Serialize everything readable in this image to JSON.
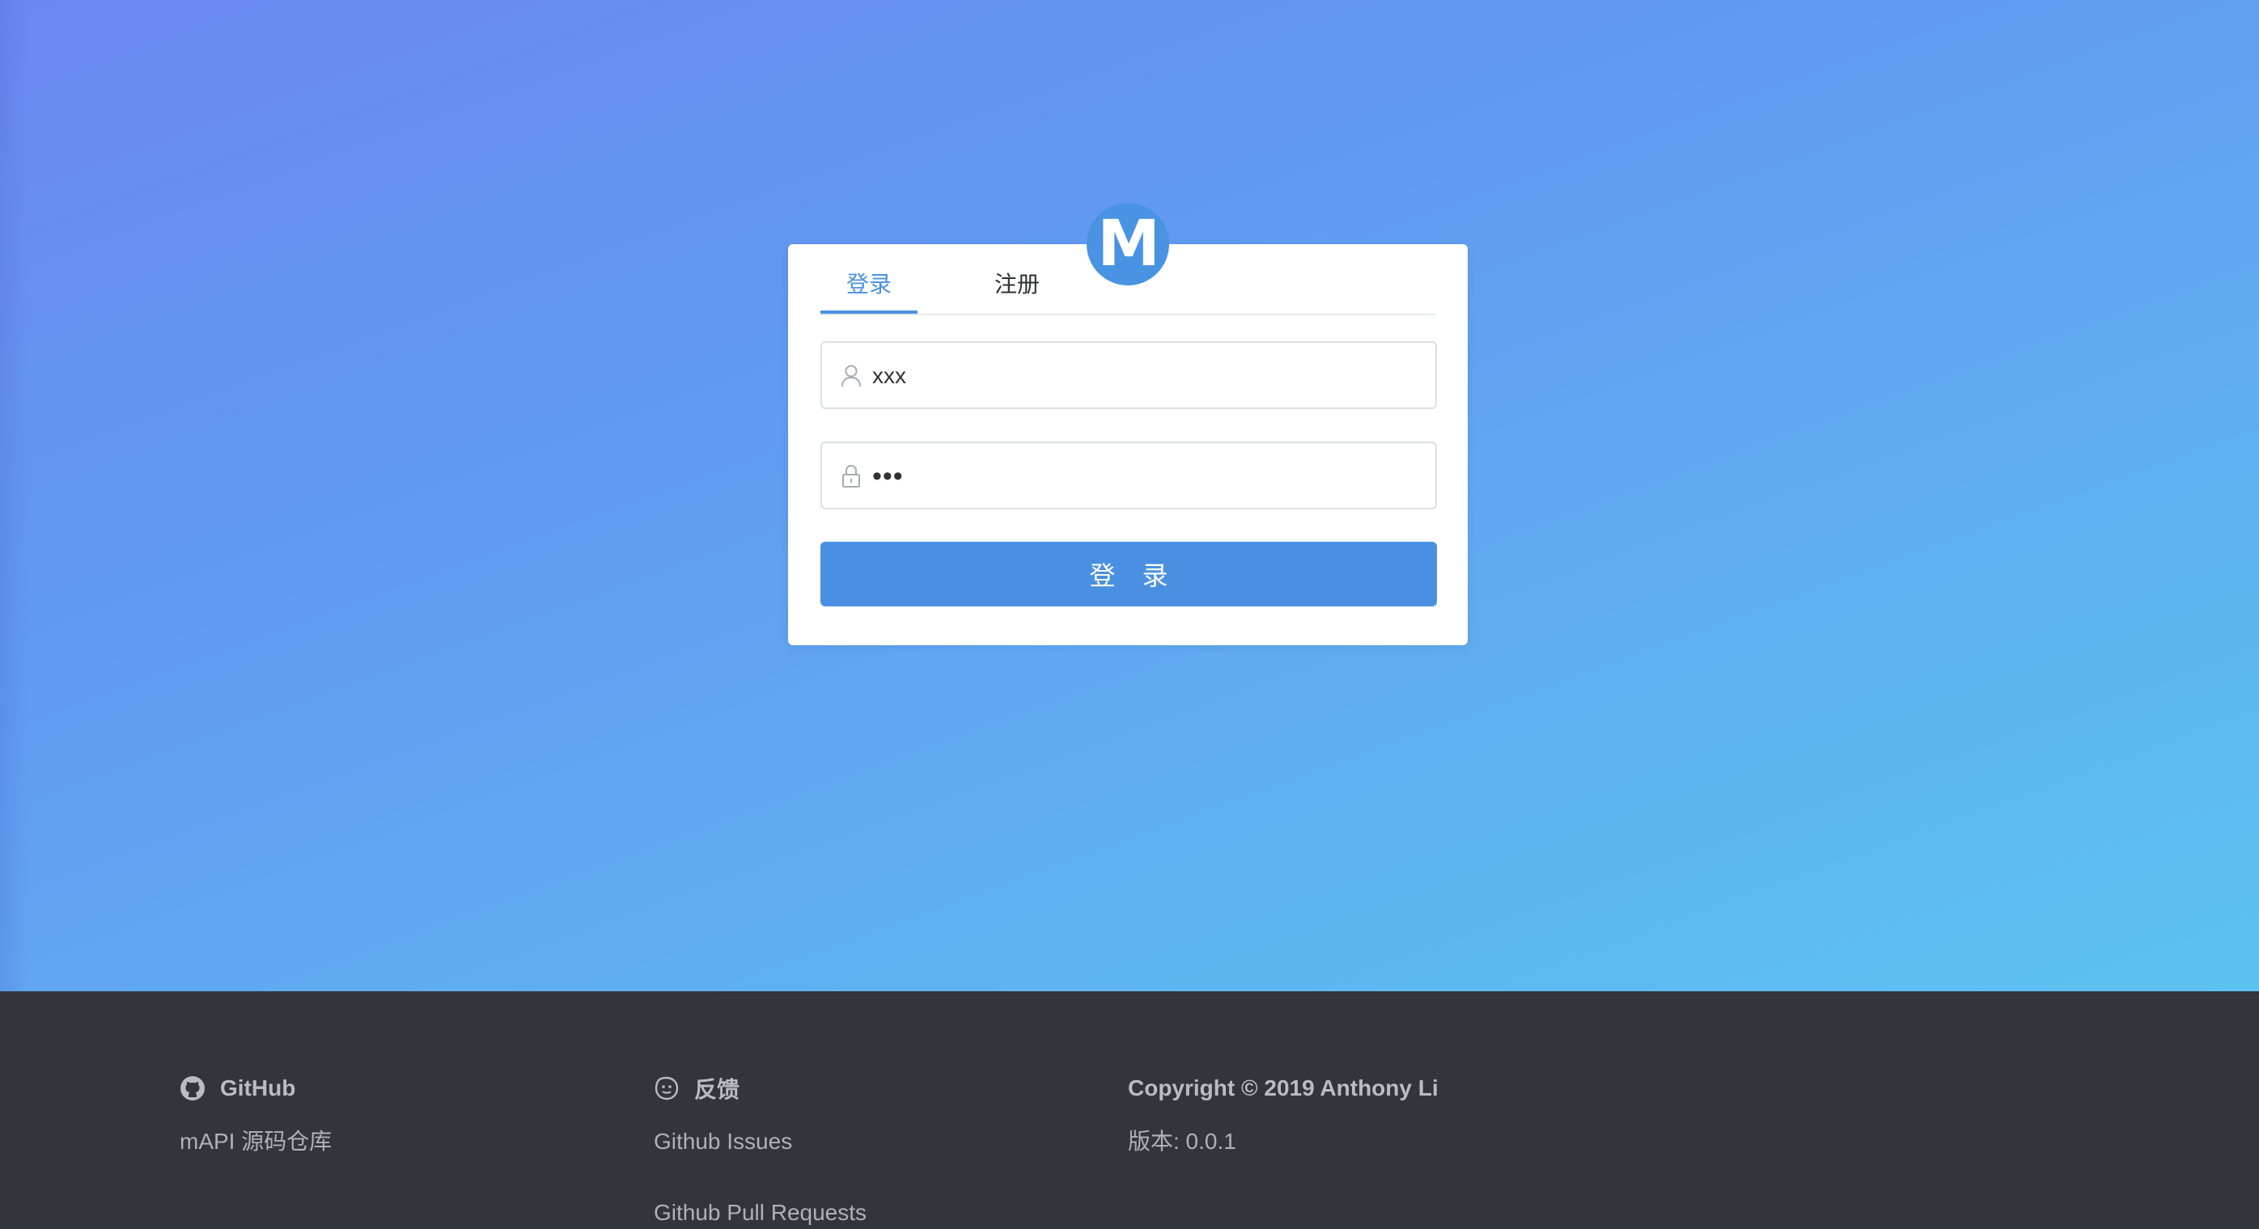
{
  "logo": {
    "letter": "M",
    "color": "#4a93e2"
  },
  "tabs": [
    {
      "label": "登录",
      "active": true
    },
    {
      "label": "注册",
      "active": false
    }
  ],
  "form": {
    "username": {
      "value": "xxx",
      "icon": "user-icon"
    },
    "password": {
      "value": "•••",
      "icon": "lock-icon"
    },
    "submit_label": "登 录"
  },
  "footer": {
    "github": {
      "heading": "GitHub",
      "icon": "github-icon",
      "links": [
        "mAPI 源码仓库"
      ]
    },
    "feedback": {
      "heading": "反馈",
      "icon": "smile-icon",
      "links": [
        "Github Issues",
        "Github Pull Requests"
      ]
    },
    "about": {
      "copyright": "Copyright © 2019 Anthony Li",
      "version": "版本: 0.0.1"
    }
  },
  "colors": {
    "accent": "#4a90e2",
    "footer_bg": "#323539"
  }
}
